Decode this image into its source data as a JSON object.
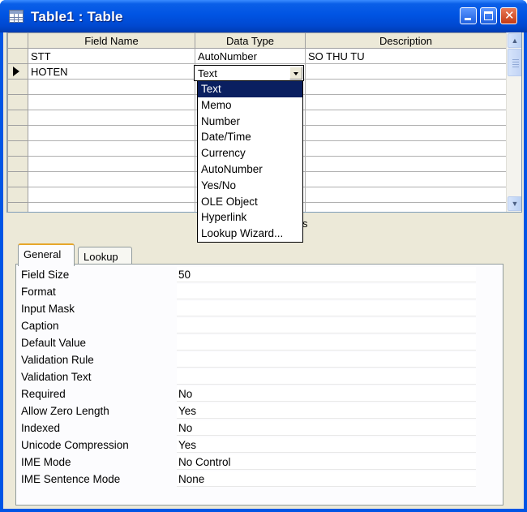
{
  "window": {
    "title": "Table1 : Table"
  },
  "grid": {
    "columns": [
      "Field Name",
      "Data Type",
      "Description"
    ],
    "rows": [
      {
        "field": "STT",
        "type": "AutoNumber",
        "desc": "SO THU TU"
      },
      {
        "field": "HOTEN",
        "type": "Text",
        "desc": ""
      }
    ]
  },
  "dropdown": {
    "selected": "Text",
    "options": [
      "Text",
      "Memo",
      "Number",
      "Date/Time",
      "Currency",
      "AutoNumber",
      "Yes/No",
      "OLE Object",
      "Hyperlink",
      "Lookup Wizard..."
    ]
  },
  "hint_fragment": "s",
  "tabs": [
    "General",
    "Lookup"
  ],
  "properties": [
    {
      "label": "Field Size",
      "value": "50"
    },
    {
      "label": "Format",
      "value": ""
    },
    {
      "label": "Input Mask",
      "value": ""
    },
    {
      "label": "Caption",
      "value": ""
    },
    {
      "label": "Default Value",
      "value": ""
    },
    {
      "label": "Validation Rule",
      "value": ""
    },
    {
      "label": "Validation Text",
      "value": ""
    },
    {
      "label": "Required",
      "value": "No"
    },
    {
      "label": "Allow Zero Length",
      "value": "Yes"
    },
    {
      "label": "Indexed",
      "value": "No"
    },
    {
      "label": "Unicode Compression",
      "value": "Yes"
    },
    {
      "label": "IME Mode",
      "value": "No Control"
    },
    {
      "label": "IME Sentence Mode",
      "value": "None"
    }
  ],
  "icons": {
    "window": "table-icon",
    "minimize": "minimize-icon",
    "maximize": "maximize-icon",
    "close": "close-icon"
  },
  "colors": {
    "titlebar": "#0054e3",
    "selection": "#0a1f60",
    "tab_highlight": "#e6a72c"
  }
}
